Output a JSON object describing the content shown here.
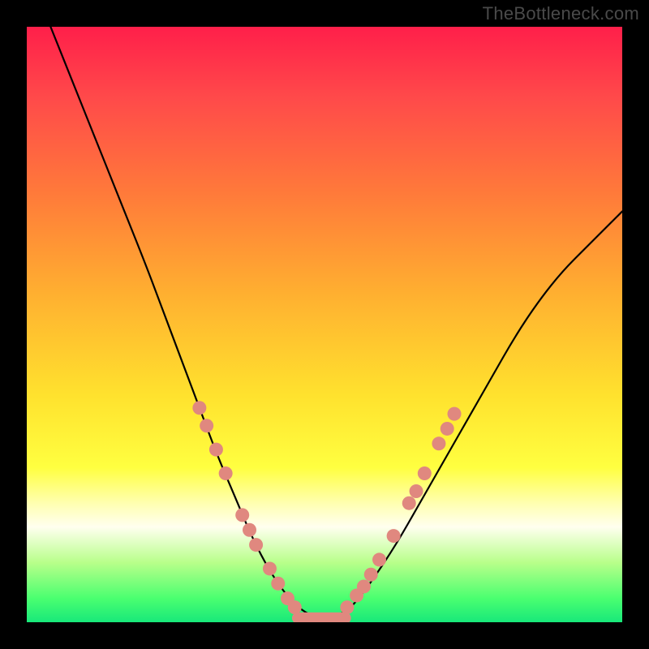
{
  "watermark": "TheBottleneck.com",
  "colors": {
    "dot": "#e0887f",
    "curve": "#000000",
    "frame": "#000000"
  },
  "chart_data": {
    "type": "line",
    "title": "",
    "xlabel": "",
    "ylabel": "",
    "xlim": [
      0,
      100
    ],
    "ylim": [
      0,
      100
    ],
    "note": "Stylized bottleneck V-curve on rainbow gradient. No axes or tick labels are visible. Y estimated from curve position within 734px plot area (0 at bottom, 100 at top). X is horizontal position (0 left, 100 right).",
    "series": [
      {
        "name": "bottleneck-curve",
        "x": [
          4,
          8,
          12,
          16,
          20,
          23,
          26,
          29,
          32,
          35,
          37.5,
          40,
          42.5,
          45,
          47,
          49,
          51,
          53,
          55,
          58,
          62,
          66,
          70,
          74,
          78,
          82,
          86,
          90,
          94,
          98,
          100
        ],
        "y": [
          100,
          90,
          80,
          70,
          60,
          52,
          44,
          36,
          28,
          21,
          15,
          10,
          6,
          3,
          1.5,
          0.7,
          0.7,
          1.5,
          3,
          7,
          13,
          20,
          27,
          34,
          41,
          48,
          54,
          59,
          63,
          67,
          69
        ]
      }
    ],
    "flat_segment": {
      "x_start": 45.5,
      "x_end": 53.5,
      "y": 0.7
    },
    "markers_left": [
      {
        "x": 29.0,
        "y": 36
      },
      {
        "x": 30.2,
        "y": 33
      },
      {
        "x": 31.8,
        "y": 29
      },
      {
        "x": 33.4,
        "y": 25
      },
      {
        "x": 36.2,
        "y": 18
      },
      {
        "x": 37.4,
        "y": 15.5
      },
      {
        "x": 38.5,
        "y": 13
      },
      {
        "x": 40.8,
        "y": 9
      },
      {
        "x": 42.2,
        "y": 6.5
      },
      {
        "x": 43.8,
        "y": 4
      },
      {
        "x": 45.0,
        "y": 2.5
      }
    ],
    "markers_right": [
      {
        "x": 53.8,
        "y": 2.5
      },
      {
        "x": 55.4,
        "y": 4.5
      },
      {
        "x": 56.6,
        "y": 6
      },
      {
        "x": 57.8,
        "y": 8
      },
      {
        "x": 59.2,
        "y": 10.5
      },
      {
        "x": 61.6,
        "y": 14.5
      },
      {
        "x": 64.2,
        "y": 20
      },
      {
        "x": 65.4,
        "y": 22
      },
      {
        "x": 66.8,
        "y": 25
      },
      {
        "x": 69.2,
        "y": 30
      },
      {
        "x": 70.6,
        "y": 32.5
      },
      {
        "x": 71.8,
        "y": 35
      }
    ]
  }
}
